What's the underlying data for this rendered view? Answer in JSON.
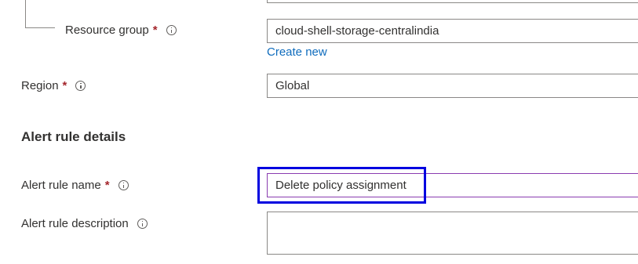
{
  "resource_group": {
    "label": "Resource group",
    "required_mark": "*",
    "value": "cloud-shell-storage-centralindia",
    "create_new": "Create new"
  },
  "region": {
    "label": "Region",
    "required_mark": "*",
    "value": "Global"
  },
  "alert_rule_details": {
    "title": "Alert rule details",
    "name": {
      "label": "Alert rule name",
      "required_mark": "*",
      "value": "Delete policy assignment"
    },
    "description": {
      "label": "Alert rule description",
      "value": ""
    }
  },
  "colors": {
    "required": "#a4262c",
    "link": "#0f6cbd",
    "highlight": "#0000e0",
    "active_border": "#8a3cb0"
  },
  "icons": [
    "info-icon"
  ]
}
